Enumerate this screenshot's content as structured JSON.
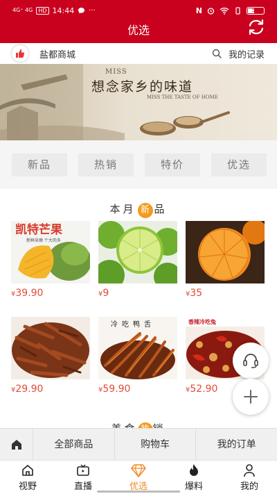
{
  "status_bar": {
    "signal": "4G⁺ 4G",
    "hd": "HD",
    "time": "14:44",
    "battery": "53"
  },
  "header": {
    "title": "优选",
    "refresh_icon": "refresh-icon"
  },
  "shop_bar": {
    "icon": "thumbs-up-icon",
    "name": "盐都商城",
    "search_icon": "search-icon",
    "record_label": "我的记录"
  },
  "banner": {
    "miss": "MISS",
    "slogan": "想念家乡的味道",
    "sub": "MISS  THE  TASTE  OF  HOME"
  },
  "categories": [
    "新品",
    "热销",
    "特价",
    "优选"
  ],
  "section_new": {
    "prefix": "本月",
    "badge": "新",
    "suffix": "品"
  },
  "products": [
    {
      "price": "39.90",
      "image_text": "凯特芒果",
      "image_sub": "新鲜采摘 个大肉多"
    },
    {
      "price": "9"
    },
    {
      "price": "35"
    },
    {
      "price": "29.90"
    },
    {
      "price": "59.90",
      "image_text": "冷吃鸭舌"
    },
    {
      "price": "52.90",
      "image_text": "香辣冷吃兔"
    }
  ],
  "currency": "¥",
  "section_hot": {
    "prefix": "美食",
    "badge": "热",
    "suffix": "销"
  },
  "shop_nav": {
    "items": [
      "全部商品",
      "购物车",
      "我的订单"
    ],
    "home_icon": "home-icon"
  },
  "tabbar": {
    "items": [
      {
        "label": "视野",
        "icon": "house-icon"
      },
      {
        "label": "直播",
        "icon": "tv-icon"
      },
      {
        "label": "优选",
        "icon": "diamond-icon",
        "active": true
      },
      {
        "label": "爆料",
        "icon": "fire-icon"
      },
      {
        "label": "我的",
        "icon": "person-icon"
      }
    ]
  },
  "colors": {
    "brand": "#c9001e",
    "accent": "#f08a24",
    "price": "#e24a3a",
    "badge": "#f39b1c"
  }
}
